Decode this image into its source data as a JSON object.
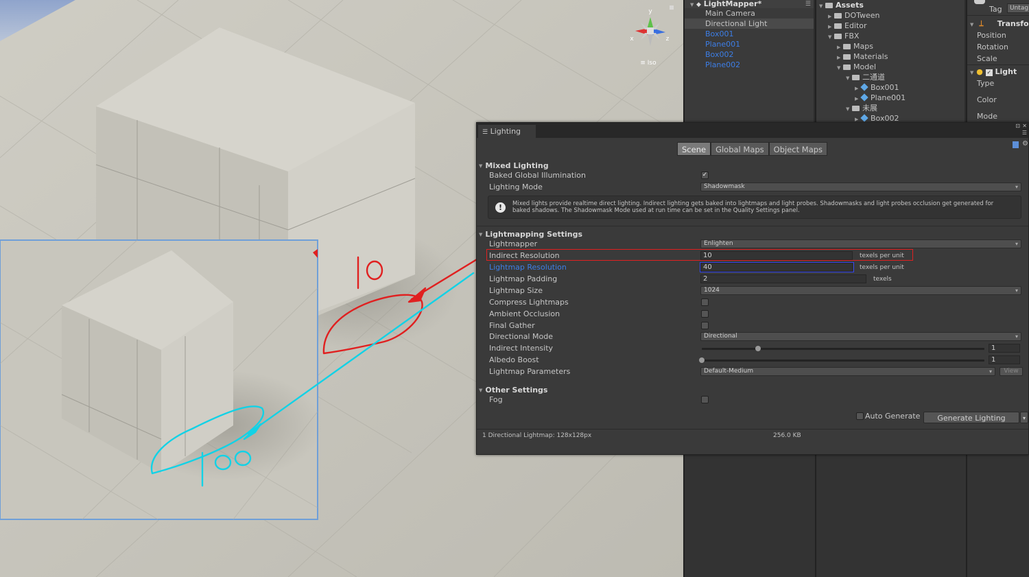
{
  "scene": {
    "iso_label": "≡ Iso",
    "gizmo": {
      "y": "y",
      "x": "x",
      "z": "z"
    },
    "annotations": {
      "red_note": "10",
      "cyan_note": "100"
    }
  },
  "hierarchy": {
    "title": "LightMapper*",
    "items": [
      {
        "label": "Main Camera",
        "style": "normal"
      },
      {
        "label": "Directional Light",
        "style": "selected"
      },
      {
        "label": "Box001",
        "style": "blue"
      },
      {
        "label": "Plane001",
        "style": "blue"
      },
      {
        "label": "Box002",
        "style": "blue"
      },
      {
        "label": "Plane002",
        "style": "blue"
      }
    ]
  },
  "project": {
    "title": "Assets",
    "items": [
      {
        "label": "DOTween",
        "icon": "folder-icon",
        "depth": 1,
        "expanded": false
      },
      {
        "label": "Editor",
        "icon": "folder-icon",
        "depth": 1,
        "expanded": false
      },
      {
        "label": "FBX",
        "icon": "folder-icon",
        "depth": 1,
        "expanded": true
      },
      {
        "label": "Maps",
        "icon": "folder-icon",
        "depth": 2,
        "expanded": false
      },
      {
        "label": "Materials",
        "icon": "folder-icon",
        "depth": 2,
        "expanded": false
      },
      {
        "label": "Model",
        "icon": "folder-icon",
        "depth": 2,
        "expanded": true
      },
      {
        "label": "二通道",
        "icon": "folder-icon",
        "depth": 3,
        "expanded": true
      },
      {
        "label": "Box001",
        "icon": "mesh-icon",
        "depth": 4,
        "expanded": false
      },
      {
        "label": "Plane001",
        "icon": "mesh-icon",
        "depth": 4,
        "expanded": false
      },
      {
        "label": "未展",
        "icon": "folder-icon",
        "depth": 3,
        "expanded": true
      },
      {
        "label": "Box002",
        "icon": "mesh-icon",
        "depth": 4,
        "expanded": false
      }
    ]
  },
  "inspector": {
    "tag_label": "Tag",
    "tag_value": "Untag",
    "transform_title": "Transfo",
    "transform_fields": [
      "Position",
      "Rotation",
      "Scale"
    ],
    "light_title": "Light",
    "light_fields": [
      "Type",
      "Color",
      "Mode"
    ]
  },
  "lighting": {
    "window_title": "Lighting",
    "tabs": [
      "Scene",
      "Global Maps",
      "Object Maps"
    ],
    "active_tab": "Scene",
    "mixed": {
      "title": "Mixed Lighting",
      "baked_gi_label": "Baked Global Illumination",
      "baked_gi": true,
      "mode_label": "Lighting Mode",
      "mode_value": "Shadowmask",
      "info": "Mixed lights provide realtime direct lighting. Indirect lighting gets baked into lightmaps and light probes. Shadowmasks and light probes occlusion get generated for baked shadows. The Shadowmask Mode used at run time can be set in the Quality Settings panel."
    },
    "lightmapping": {
      "title": "Lightmapping Settings",
      "lightmapper_label": "Lightmapper",
      "lightmapper_value": "Enlighten",
      "indirect_label": "Indirect Resolution",
      "indirect_value": "10",
      "indirect_unit": "texels per unit",
      "lm_res_label": "Lightmap Resolution",
      "lm_res_value": "40",
      "lm_res_unit": "texels per unit",
      "padding_label": "Lightmap Padding",
      "padding_value": "2",
      "padding_unit": "texels",
      "size_label": "Lightmap Size",
      "size_value": "1024",
      "compress_label": "Compress Lightmaps",
      "compress": false,
      "ao_label": "Ambient Occlusion",
      "ao": false,
      "fg_label": "Final Gather",
      "fg": false,
      "dir_label": "Directional Mode",
      "dir_value": "Directional",
      "indirect_int_label": "Indirect Intensity",
      "indirect_int_value": "1",
      "indirect_int_frac": 0.2,
      "albedo_label": "Albedo Boost",
      "albedo_value": "1",
      "albedo_frac": 0.0,
      "params_label": "Lightmap Parameters",
      "params_value": "Default-Medium",
      "view_label": "View"
    },
    "other": {
      "title": "Other Settings",
      "fog_label": "Fog",
      "fog": false
    },
    "auto_generate_label": "Auto Generate",
    "generate_label": "Generate Lighting",
    "status_left": "1 Directional Lightmap: 128x128px",
    "status_size": "256.0 KB"
  },
  "colors": {
    "annotation_red": "#e02020",
    "annotation_cyan": "#12d2e6",
    "selection_blue": "#3d7ee6"
  }
}
